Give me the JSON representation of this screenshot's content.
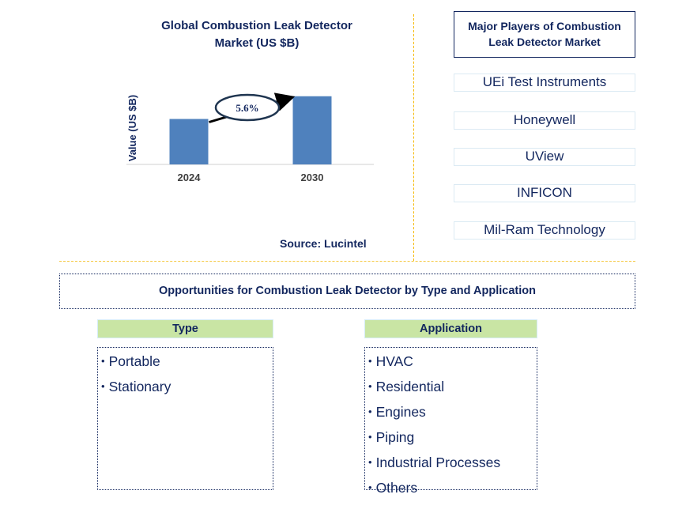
{
  "chart_data": {
    "type": "bar",
    "title": "Global Combustion Leak Detector Market (US $B)",
    "title_lines": [
      "Global Combustion Leak Detector",
      "Market (US $B)"
    ],
    "categories": [
      "2024",
      "2030"
    ],
    "values": [
      1.0,
      1.5
    ],
    "value_note": "relative bar heights; no axis values printed",
    "xlabel": "",
    "ylabel": "Value (US $B)",
    "ylim": [
      0,
      1.6
    ],
    "grid": false,
    "annotation": {
      "label": "5.6%",
      "meaning": "CAGR 2024-2030",
      "shape": "ellipse-with-arrow"
    },
    "bar_color": "#4f81bd",
    "source": "Source: Lucintel"
  },
  "players": {
    "title": "Major Players of Combustion Leak Detector Market",
    "items": [
      "UEi Test Instruments",
      "Honeywell",
      "UView",
      "INFICON",
      "Mil-Ram Technology"
    ]
  },
  "opportunities": {
    "title": "Opportunities for Combustion Leak Detector by Type and Application",
    "type": {
      "header": "Type",
      "items": [
        "Portable",
        "Stationary"
      ]
    },
    "application": {
      "header": "Application",
      "items": [
        "HVAC",
        "Residential",
        "Engines",
        "Piping",
        "Industrial Processes",
        "Others"
      ]
    }
  },
  "colors": {
    "text": "#12265e",
    "divider": "#f5b800",
    "category_header_bg": "#c9e5a4",
    "player_border": "#dbeaf3"
  }
}
